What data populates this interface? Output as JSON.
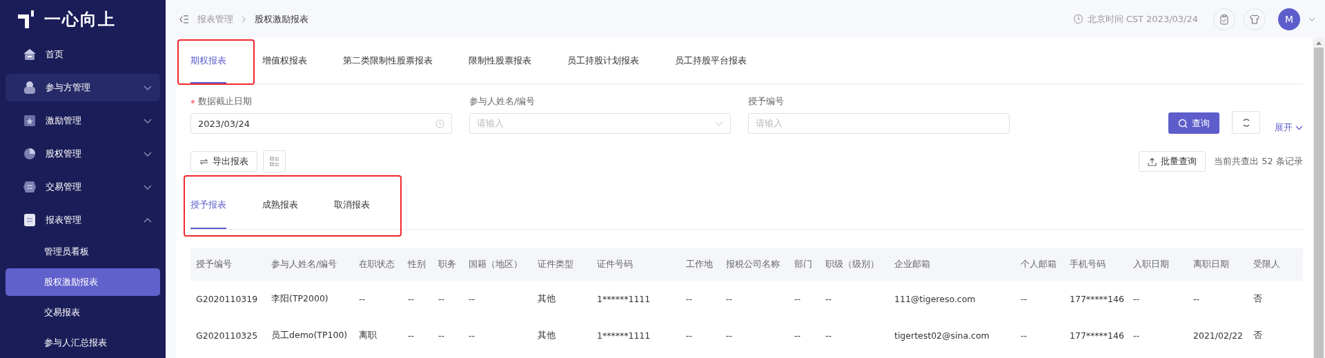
{
  "sidebar": {
    "logo": "一心向上",
    "items": [
      {
        "label": "首页",
        "kind": "leaf",
        "hovered": false
      },
      {
        "label": "参与方管理",
        "kind": "group",
        "expanded": false,
        "hovered": true
      },
      {
        "label": "激励管理",
        "kind": "group",
        "expanded": false,
        "hovered": false
      },
      {
        "label": "股权管理",
        "kind": "group",
        "expanded": false,
        "hovered": false
      },
      {
        "label": "交易管理",
        "kind": "group",
        "expanded": false,
        "hovered": false
      },
      {
        "label": "报表管理",
        "kind": "group",
        "expanded": true,
        "hovered": false,
        "children": [
          {
            "label": "管理员看板",
            "selected": false
          },
          {
            "label": "股权激励报表",
            "selected": true
          },
          {
            "label": "交易报表",
            "selected": false
          },
          {
            "label": "参与人汇总报表",
            "selected": false
          }
        ]
      }
    ]
  },
  "header": {
    "breadcrumb": [
      "报表管理",
      "股权激励报表"
    ],
    "clock": "北京时间 CST 2023/03/24",
    "avatar": "M"
  },
  "tabs": {
    "highlight_selected": true,
    "items": [
      {
        "label": "期权报表",
        "selected": true
      },
      {
        "label": "增值权报表",
        "selected": false
      },
      {
        "label": "第二类限制性股票报表",
        "selected": false
      },
      {
        "label": "限制性股票报表",
        "selected": false
      },
      {
        "label": "员工持股计划报表",
        "selected": false
      },
      {
        "label": "员工持股平台报表",
        "selected": false
      }
    ]
  },
  "filters": [
    {
      "label": "数据截止日期",
      "required": true,
      "kind": "date",
      "value": "2023/03/24"
    },
    {
      "label": "参与人姓名/编号",
      "required": false,
      "kind": "select",
      "placeholder": "请输入"
    },
    {
      "label": "授予编号",
      "required": false,
      "kind": "text",
      "placeholder": "请输入"
    }
  ],
  "search_button": "查询",
  "expand_link": "展开",
  "export_button": "导出报表",
  "batch_button": "批量查询",
  "record_count": "当前共查出 52 条记录",
  "sub_tabs": {
    "highlighted": true,
    "items": [
      {
        "label": "授予报表",
        "selected": true
      },
      {
        "label": "成熟报表",
        "selected": false
      },
      {
        "label": "取消报表",
        "selected": false
      }
    ]
  },
  "table": {
    "columns": [
      "授予编号",
      "参与人姓名/编号",
      "在职状态",
      "性别",
      "职务",
      "国籍（地区）",
      "证件类型",
      "证件号码",
      "工作地",
      "报税公司名称",
      "部门",
      "职级（级别）",
      "企业邮箱",
      "个人邮箱",
      "手机号码",
      "入职日期",
      "离职日期",
      "受限人"
    ],
    "rows": [
      [
        "G2020110319",
        "李阳(TP2000)",
        "--",
        "--",
        "--",
        "--",
        "其他",
        "1******1111",
        "--",
        "--",
        "--",
        "--",
        "111@tigereso.com",
        "--",
        "177*****146",
        "--",
        "--",
        "否"
      ],
      [
        "G2020110325",
        "员工demo(TP100)",
        "离职",
        "--",
        "--",
        "--",
        "其他",
        "1******1111",
        "--",
        "--",
        "--",
        "--",
        "tigertest02@sina.com",
        "--",
        "177*****146",
        "--",
        "2021/02/22",
        "否"
      ]
    ]
  }
}
